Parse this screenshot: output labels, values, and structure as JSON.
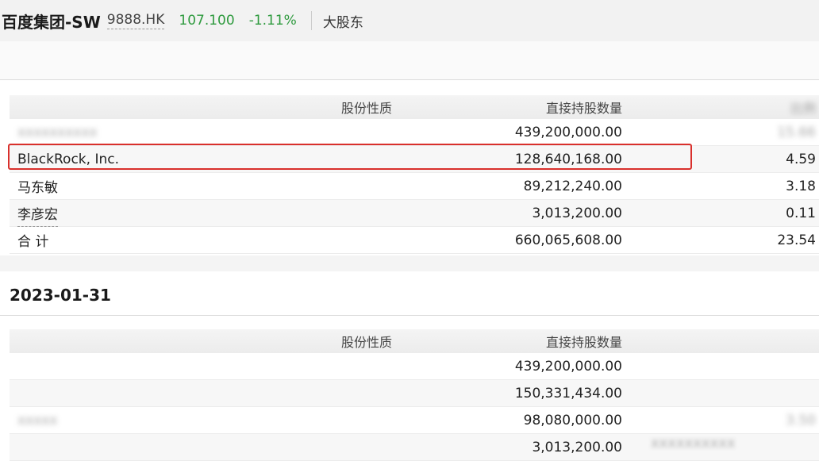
{
  "header": {
    "company": "百度集团-SW",
    "ticker": "9888.HK",
    "price": "107.100",
    "change": "-1.11%",
    "tab": "大股东"
  },
  "table1": {
    "headers": {
      "nature": "股份性质",
      "shares": "直接持股数量"
    },
    "rows": [
      {
        "name": "",
        "shares": "439,200,000.00",
        "pct": ""
      },
      {
        "name": "BlackRock, Inc.",
        "shares": "128,640,168.00",
        "pct": "4.59"
      },
      {
        "name": "马东敏",
        "shares": "89,212,240.00",
        "pct": "3.18"
      },
      {
        "name": "李彦宏",
        "shares": "3,013,200.00",
        "pct": "0.11"
      },
      {
        "name": "合 计",
        "shares": "660,065,608.00",
        "pct": "23.54"
      }
    ]
  },
  "section2": {
    "date": "2023-01-31",
    "headers": {
      "nature": "股份性质",
      "shares": "直接持股数量"
    },
    "rows": [
      {
        "name": "",
        "shares": "439,200,000.00",
        "pct": ""
      },
      {
        "name": "",
        "shares": "150,331,434.00",
        "pct": ""
      },
      {
        "name": "",
        "shares": "98,080,000.00",
        "pct": ""
      },
      {
        "name": "",
        "shares": "3,013,200.00",
        "pct": ""
      }
    ]
  },
  "colors": {
    "up_down_green": "#2e9a3e",
    "highlight_red": "#d9302c"
  }
}
